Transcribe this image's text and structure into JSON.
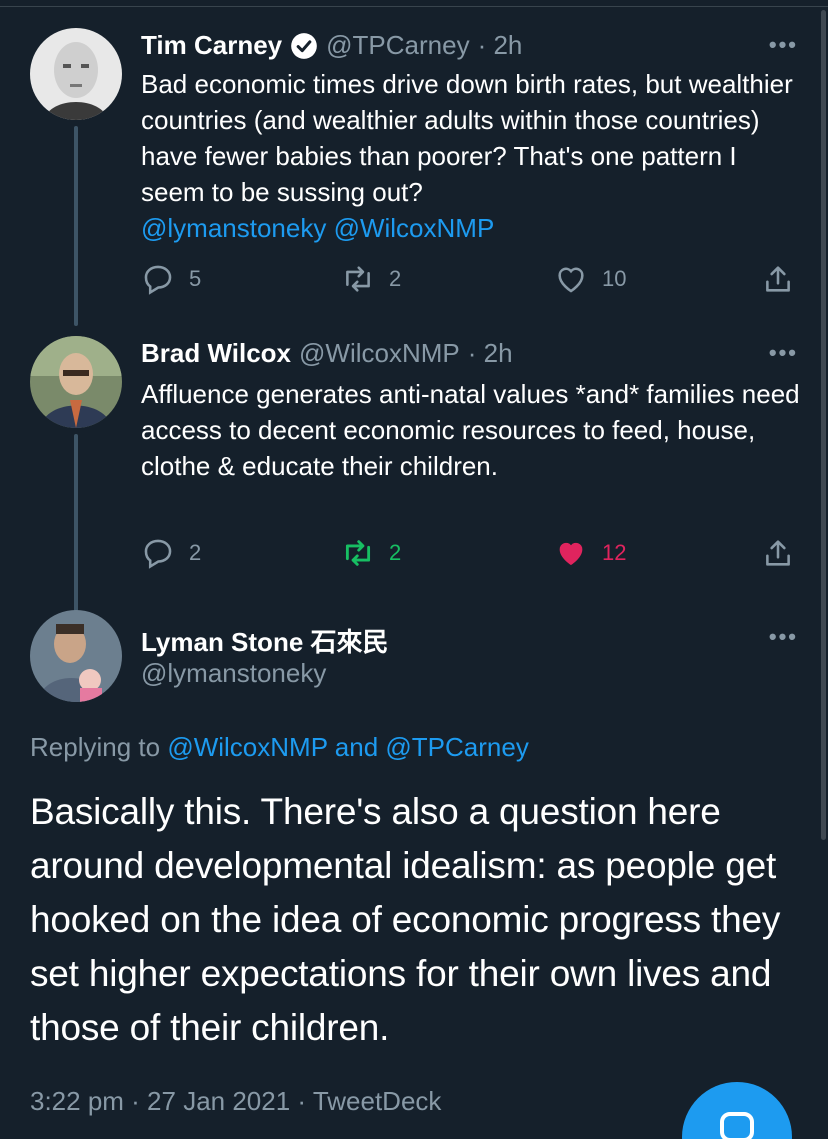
{
  "tweets": [
    {
      "name": "Tim Carney",
      "handle": "@TPCarney",
      "time": "· 2h",
      "verified": true,
      "text_before": "Bad economic times drive down birth rates, but wealthier countries (and wealthier adults within those countries) have fewer babies than poorer? That's one pattern I seem to be sussing out?",
      "mentions": "@lymanstoneky @WilcoxNMP",
      "replies": "5",
      "retweets": "2",
      "likes": "10"
    },
    {
      "name": "Brad Wilcox",
      "handle": "@WilcoxNMP",
      "time": "· 2h",
      "text": "Affluence generates anti-natal values *and* families need access to decent economic resources to feed, house, clothe & educate their children.",
      "replies": "2",
      "retweets": "2",
      "likes": "12"
    }
  ],
  "main": {
    "name": "Lyman Stone 石來民",
    "handle": "@lymanstoneky",
    "replying_prefix": "Replying to",
    "replying_to": "@WilcoxNMP and @TPCarney",
    "text": "Basically this. There's also a question here around developmental idealism: as people get hooked on the idea of economic progress they set higher expectations for their own lives and those of their children.",
    "meta": "3:22 pm · 27 Jan 2021 · TweetDeck"
  },
  "more_label": "•••",
  "colors": {
    "background": "#15202b",
    "accent": "#1d9bf0",
    "muted": "#8899a6",
    "retweeted": "#17bf63",
    "liked": "#e0245e"
  },
  "icons": [
    "reply-icon",
    "retweet-icon",
    "like-icon",
    "share-icon",
    "verified-icon",
    "more-icon",
    "compose-icon"
  ]
}
